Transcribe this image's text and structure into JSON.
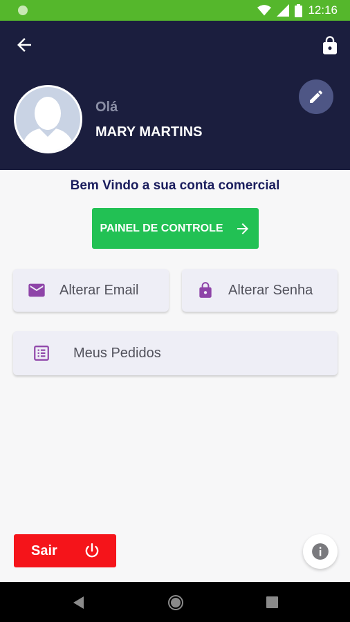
{
  "status_bar": {
    "time": "12:16",
    "color": "#55b72c",
    "icons": [
      "wifi-icon",
      "signal-icon",
      "battery-icon"
    ]
  },
  "header": {
    "background": "#1b1e3e",
    "greeting": "Olá",
    "user_name": "MARY MARTINS",
    "icons": [
      "back-arrow-icon",
      "lock-icon",
      "pencil-icon",
      "avatar-silhouette-icon"
    ]
  },
  "main": {
    "welcome_text": "Bem Vindo a sua conta comercial",
    "panel_button_label": "PAINEL DE CONTROLE",
    "panel_button_color": "#22c154",
    "cards": {
      "email_label": "Alterar Email",
      "senha_label": "Alterar Senha",
      "pedidos_label": "Meus Pedidos"
    },
    "icon_color": "#8e44a8"
  },
  "footer": {
    "sair_label": "Sair",
    "sair_color": "#f5141a",
    "icons": [
      "power-icon",
      "info-icon"
    ]
  },
  "nav_bar": {
    "icons": [
      "nav-back-icon",
      "nav-home-icon",
      "nav-recent-icon"
    ]
  }
}
